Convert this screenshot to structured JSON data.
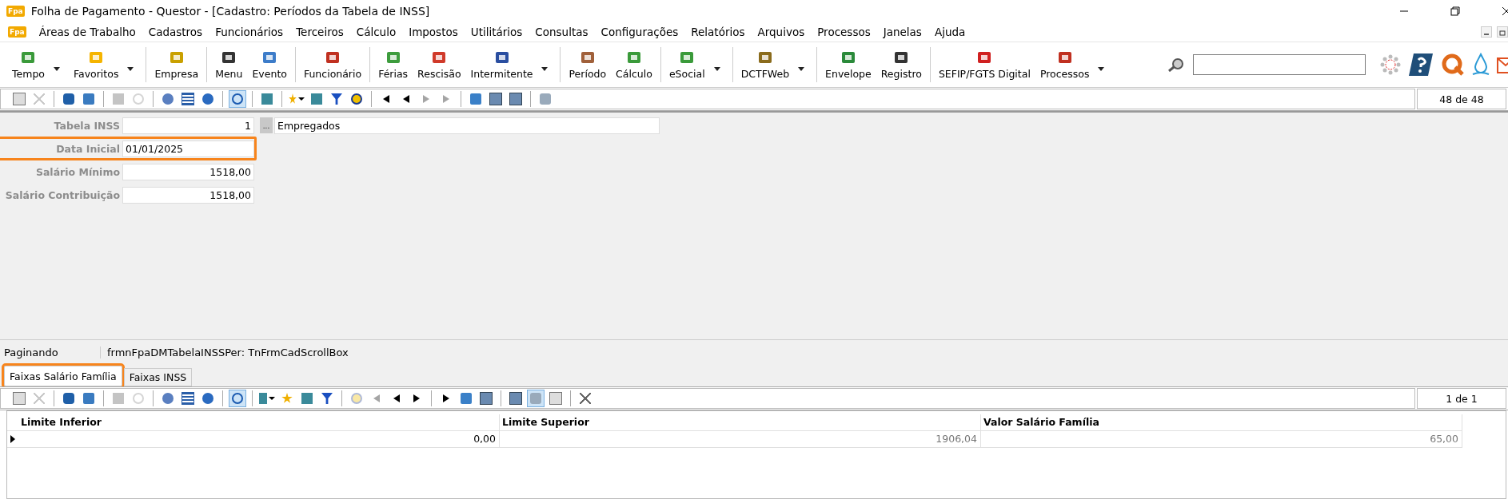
{
  "window": {
    "title": "Folha de Pagamento - Questor - [Cadastro: Períodos da Tabela de INSS]",
    "app_badge": "Fpa"
  },
  "menu": {
    "badge": "Fpa",
    "items": [
      "Áreas de Trabalho",
      "Cadastros",
      "Funcionários",
      "Terceiros",
      "Cálculo",
      "Impostos",
      "Utilitários",
      "Consultas",
      "Configurações",
      "Relatórios",
      "Arquivos",
      "Processos",
      "Janelas",
      "Ajuda"
    ]
  },
  "toolbar": [
    {
      "kind": "button",
      "label": "Tempo",
      "dropdown": true
    },
    {
      "kind": "button",
      "label": "Favoritos",
      "dropdown": true
    },
    {
      "kind": "separator"
    },
    {
      "kind": "button",
      "label": "Empresa",
      "dropdown": false
    },
    {
      "kind": "separator"
    },
    {
      "kind": "button",
      "label": "Menu",
      "dropdown": false
    },
    {
      "kind": "button",
      "label": "Evento",
      "dropdown": false
    },
    {
      "kind": "separator"
    },
    {
      "kind": "button",
      "label": "Funcionário",
      "dropdown": false
    },
    {
      "kind": "separator"
    },
    {
      "kind": "button",
      "label": "Férias",
      "dropdown": false
    },
    {
      "kind": "button",
      "label": "Rescisão",
      "dropdown": false
    },
    {
      "kind": "button",
      "label": "Intermitente",
      "dropdown": true
    },
    {
      "kind": "separator"
    },
    {
      "kind": "button",
      "label": "Período",
      "dropdown": false
    },
    {
      "kind": "button",
      "label": "Cálculo",
      "dropdown": false
    },
    {
      "kind": "separator"
    },
    {
      "kind": "button",
      "label": "eSocial",
      "dropdown": true
    },
    {
      "kind": "separator"
    },
    {
      "kind": "button",
      "label": "DCTFWeb",
      "dropdown": true
    },
    {
      "kind": "separator"
    },
    {
      "kind": "button",
      "label": "Envelope",
      "dropdown": false
    },
    {
      "kind": "button",
      "label": "Registro",
      "dropdown": false
    },
    {
      "kind": "separator"
    },
    {
      "kind": "button",
      "label": "SEFIP/FGTS Digital",
      "dropdown": false
    },
    {
      "kind": "button",
      "label": "Processos",
      "dropdown": true
    }
  ],
  "record_toolbar": {
    "counter": "48 de 48",
    "tools": [
      {
        "kind": "button",
        "disabled": false,
        "pressed": false
      },
      {
        "kind": "button",
        "disabled": true,
        "pressed": false
      },
      {
        "kind": "separator"
      },
      {
        "kind": "button",
        "disabled": false,
        "pressed": false
      },
      {
        "kind": "button",
        "disabled": false,
        "pressed": false
      },
      {
        "kind": "separator"
      },
      {
        "kind": "button",
        "disabled": true,
        "pressed": false
      },
      {
        "kind": "button",
        "disabled": true,
        "pressed": false
      },
      {
        "kind": "separator"
      },
      {
        "kind": "button",
        "disabled": false,
        "pressed": false
      },
      {
        "kind": "button",
        "disabled": false,
        "pressed": false
      },
      {
        "kind": "button",
        "disabled": false,
        "pressed": false
      },
      {
        "kind": "separator"
      },
      {
        "kind": "button",
        "disabled": false,
        "pressed": true
      },
      {
        "kind": "separator"
      },
      {
        "kind": "button",
        "disabled": false,
        "pressed": false
      },
      {
        "kind": "separator"
      },
      {
        "kind": "dropdown",
        "disabled": false,
        "pressed": false
      },
      {
        "kind": "button",
        "disabled": false,
        "pressed": false
      },
      {
        "kind": "button",
        "disabled": false,
        "pressed": false
      },
      {
        "kind": "button",
        "disabled": false,
        "pressed": false
      },
      {
        "kind": "separator"
      },
      {
        "kind": "button",
        "disabled": false,
        "pressed": false
      },
      {
        "kind": "button",
        "disabled": false,
        "pressed": false
      },
      {
        "kind": "button",
        "disabled": true,
        "pressed": false
      },
      {
        "kind": "button",
        "disabled": true,
        "pressed": false
      },
      {
        "kind": "separator"
      },
      {
        "kind": "button",
        "disabled": false,
        "pressed": false
      },
      {
        "kind": "button",
        "disabled": false,
        "pressed": false
      },
      {
        "kind": "button",
        "disabled": false,
        "pressed": false
      },
      {
        "kind": "separator"
      },
      {
        "kind": "button",
        "disabled": false,
        "pressed": false
      }
    ]
  },
  "form": {
    "fields": [
      {
        "label": "Tabela INSS",
        "value": "1",
        "lookup": "...",
        "description": "Empregados",
        "highlighted": false,
        "kind": "number"
      },
      {
        "label": "Data Inicial",
        "value": "01/01/2025",
        "highlighted": true,
        "kind": "date"
      },
      {
        "label": "Salário Mínimo",
        "value": "1518,00",
        "highlighted": false,
        "kind": "number"
      },
      {
        "label": "Salário Contribuição",
        "value": "1518,00",
        "highlighted": false,
        "kind": "number"
      }
    ]
  },
  "status_bar": {
    "state": "Paginando",
    "component": "frmnFpaDMTabelaINSSPer: TnFrmCadScrollBox"
  },
  "tabs": [
    {
      "label": "Faixas Salário Família",
      "selected": true,
      "highlighted": true
    },
    {
      "label": "Faixas INSS",
      "selected": false,
      "highlighted": false
    }
  ],
  "detail_toolbar": {
    "counter": "1 de 1",
    "tools": [
      {
        "kind": "button",
        "disabled": false,
        "pressed": false
      },
      {
        "kind": "button",
        "disabled": true,
        "pressed": false
      },
      {
        "kind": "separator"
      },
      {
        "kind": "button",
        "disabled": false,
        "pressed": false
      },
      {
        "kind": "button",
        "disabled": false,
        "pressed": false
      },
      {
        "kind": "separator"
      },
      {
        "kind": "button",
        "disabled": true,
        "pressed": false
      },
      {
        "kind": "button",
        "disabled": true,
        "pressed": false
      },
      {
        "kind": "separator"
      },
      {
        "kind": "button",
        "disabled": false,
        "pressed": false
      },
      {
        "kind": "button",
        "disabled": false,
        "pressed": false
      },
      {
        "kind": "button",
        "disabled": false,
        "pressed": false
      },
      {
        "kind": "separator"
      },
      {
        "kind": "button",
        "disabled": false,
        "pressed": true
      },
      {
        "kind": "separator"
      },
      {
        "kind": "dropdown",
        "disabled": false,
        "pressed": false
      },
      {
        "kind": "button",
        "disabled": false,
        "pressed": false
      },
      {
        "kind": "button",
        "disabled": false,
        "pressed": false
      },
      {
        "kind": "button",
        "disabled": false,
        "pressed": false
      },
      {
        "kind": "separator"
      },
      {
        "kind": "button",
        "disabled": true,
        "pressed": false
      },
      {
        "kind": "button",
        "disabled": true,
        "pressed": false
      },
      {
        "kind": "button",
        "disabled": false,
        "pressed": false
      },
      {
        "kind": "button",
        "disabled": false,
        "pressed": false
      },
      {
        "kind": "separator"
      },
      {
        "kind": "button",
        "disabled": false,
        "pressed": false
      },
      {
        "kind": "button",
        "disabled": false,
        "pressed": false
      },
      {
        "kind": "button",
        "disabled": false,
        "pressed": false
      },
      {
        "kind": "separator"
      },
      {
        "kind": "button",
        "disabled": false,
        "pressed": false
      },
      {
        "kind": "button",
        "disabled": false,
        "pressed": true
      },
      {
        "kind": "button",
        "disabled": false,
        "pressed": false
      },
      {
        "kind": "separator"
      },
      {
        "kind": "button",
        "disabled": false,
        "pressed": false
      }
    ]
  },
  "table": {
    "columns": [
      "Limite Inferior",
      "Limite Superior",
      "Valor Salário Família"
    ],
    "rows": [
      {
        "selected": true,
        "cells": [
          "0,00",
          "1906,04",
          "65,00"
        ]
      }
    ]
  }
}
